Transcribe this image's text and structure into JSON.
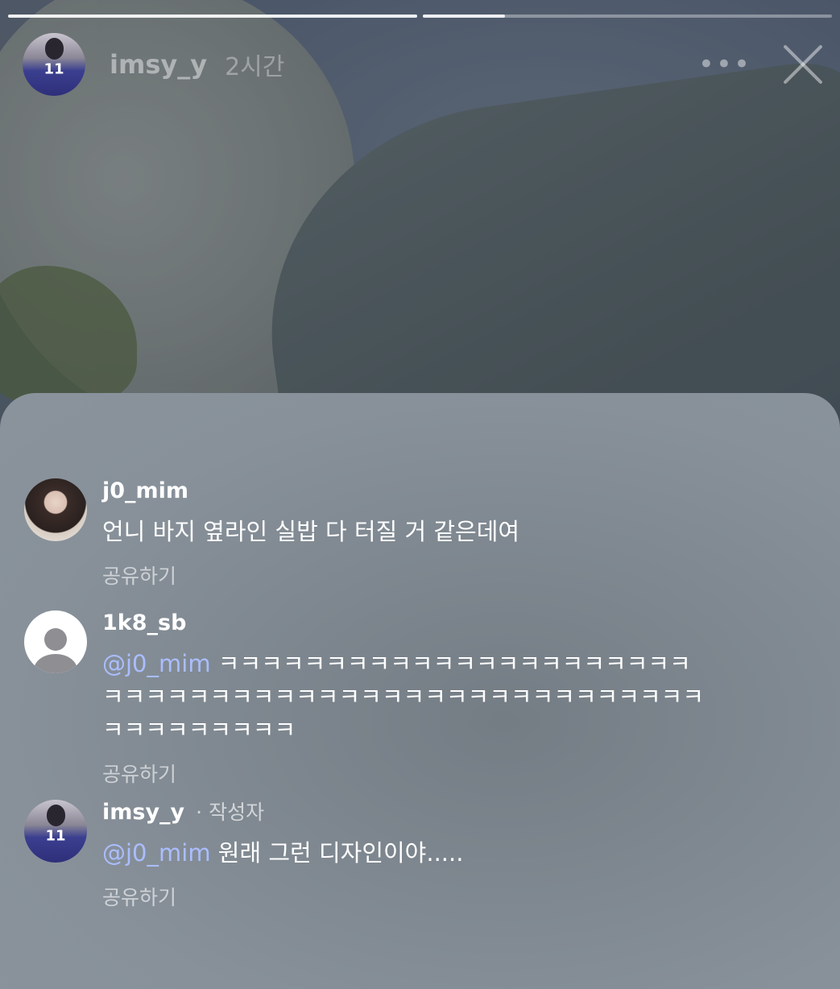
{
  "story": {
    "username": "imsy_y",
    "time": "2시간",
    "avatar_number": "11",
    "progress": [
      1.0,
      0.2
    ]
  },
  "comments": [
    {
      "username": "j0_mim",
      "author_label": "",
      "mention": "",
      "text": "언니 바지 옆라인 실밥 다 터질 거 같은데여",
      "share": "공유하기"
    },
    {
      "username": "1k8_sb",
      "author_label": "",
      "mention": "@j0_mim",
      "text": "ㅋㅋㅋㅋㅋㅋㅋㅋㅋㅋㅋㅋㅋㅋㅋㅋㅋㅋㅋㅋㅋㅋㅋㅋㅋㅋㅋㅋㅋㅋㅋㅋㅋㅋㅋㅋㅋㅋㅋㅋㅋㅋㅋㅋㅋㅋㅋㅋㅋㅋㅋㅋㅋㅋㅋㅋㅋㅋㅋ",
      "share": "공유하기"
    },
    {
      "username": "imsy_y",
      "author_label": "· 작성자",
      "mention": "@j0_mim",
      "text": "원래 그런 디자인이야.....",
      "share": "공유하기"
    }
  ],
  "icons": {
    "more": "more-icon",
    "close": "close-icon"
  },
  "colors": {
    "mention": "#aabdff"
  }
}
